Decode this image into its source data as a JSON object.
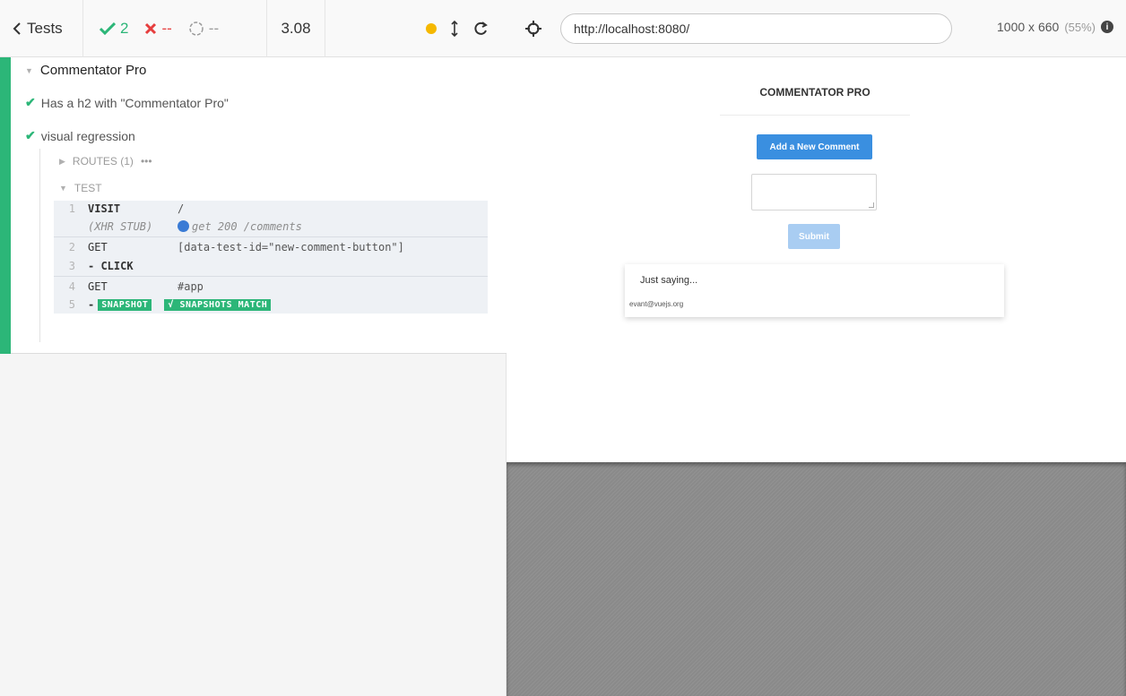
{
  "reporter": {
    "topbar": {
      "tests_label": "Tests",
      "passed": "2",
      "failed": "--",
      "pending": "--",
      "duration": "3.08"
    },
    "suite": {
      "title": "Commentator Pro",
      "tests": [
        {
          "title": "Has a h2 with \"Commentator Pro\"",
          "state": "passed"
        },
        {
          "title": "visual regression",
          "state": "passed"
        }
      ],
      "routes_label": "ROUTES (1)",
      "routes_more": "•••",
      "test_label": "TEST",
      "commands": [
        {
          "index": "1",
          "name": "VISIT",
          "message": "/"
        },
        {
          "index": "",
          "name": "(XHR STUB)",
          "message": "get 200 /comments"
        },
        {
          "index": "2",
          "name": "GET",
          "message": "[data-test-id=\"new-comment-button\"]"
        },
        {
          "index": "3",
          "name": "- CLICK",
          "message": ""
        },
        {
          "index": "4",
          "name": "GET",
          "message": "#app"
        },
        {
          "index": "5",
          "name": "- ",
          "message": ""
        }
      ],
      "snapshot_badge": "SNAPSHOT",
      "snapshot_match": "√ SNAPSHOTS MATCH"
    }
  },
  "aut": {
    "url": "http://localhost:8080/",
    "viewport_size": "1000 x 660",
    "viewport_scale": "(55%)",
    "app": {
      "title": "COMMENTATOR PRO",
      "add_button": "Add a New Comment",
      "submit_button": "Submit",
      "comment": {
        "text": "Just saying...",
        "author": "evant@vuejs.org"
      }
    }
  },
  "colors": {
    "pass": "#2cb678",
    "fail": "#e63e3e",
    "accent": "#3a8fe0",
    "xhr": "#3a7bd5"
  },
  "icons": [
    "chevron-left-icon",
    "check-icon",
    "x-icon",
    "circle-pending-icon",
    "status-dot-icon",
    "scroll-arrow-icon",
    "reload-icon",
    "crosshair-icon",
    "info-icon"
  ]
}
